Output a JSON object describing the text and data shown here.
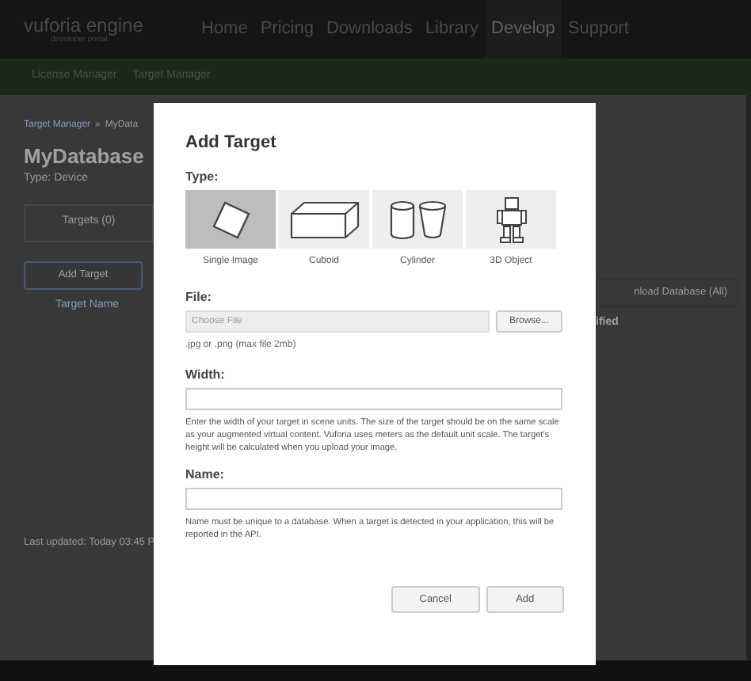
{
  "nav": {
    "logo": "vuforia engine",
    "logo_sub": "developer portal",
    "items": [
      {
        "label": "Home",
        "selected": false
      },
      {
        "label": "Pricing",
        "selected": false
      },
      {
        "label": "Downloads",
        "selected": false
      },
      {
        "label": "Library",
        "selected": false
      },
      {
        "label": "Develop",
        "selected": true
      },
      {
        "label": "Support",
        "selected": false
      }
    ]
  },
  "subnav": [
    "License Manager",
    "Target Manager"
  ],
  "page": {
    "breadcrumb": [
      "Target Manager",
      "»",
      "MyData"
    ],
    "title": "MyDatabase",
    "type": "Type: Device",
    "tab": "Targets (0)",
    "add_button": "Add Target",
    "column": "Target Name",
    "download_button": "nload Database (All)",
    "column_right": "ified",
    "footer": "Last updated: Today 03:45 P"
  },
  "dialog": {
    "title": "Add Target",
    "type_label": "Type:",
    "types": [
      {
        "label": "Single Image",
        "kind": "image",
        "selected": true
      },
      {
        "label": "Cuboid",
        "kind": "cuboid",
        "selected": false
      },
      {
        "label": "Cylinder",
        "kind": "cylinder",
        "selected": false
      },
      {
        "label": "3D Object",
        "kind": "object",
        "selected": false
      }
    ],
    "file_label": "File:",
    "file_placeholder": "Choose File",
    "browse": "Browse...",
    "file_hint": ".jpg or .png (max file 2mb)",
    "width_label": "Width:",
    "width_help": "Enter the width of your target in scene units. The size of the target should be on the same scale as your augmented virtual content. Vuforia uses meters as the default unit scale. The target's height will be calculated when you upload your image.",
    "name_label": "Name:",
    "name_help": "Name must be unique to a database. When a target is detected in your application, this will be reported in the API.",
    "buttons": [
      "Cancel",
      "Add"
    ]
  }
}
